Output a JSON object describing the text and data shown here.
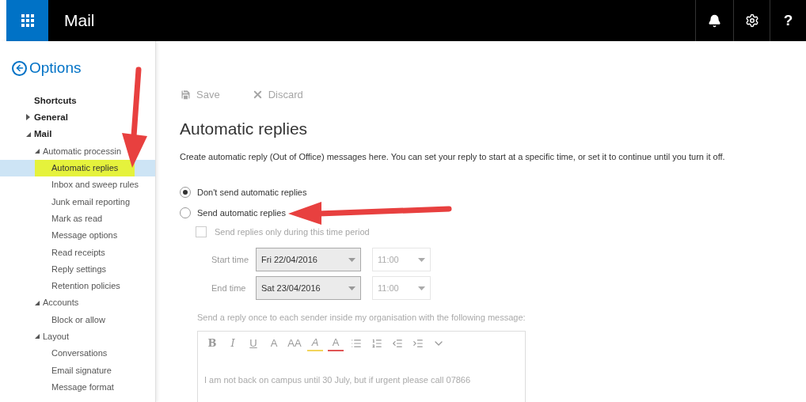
{
  "app_bar": {
    "title": "Mail",
    "help_label": "?"
  },
  "sidebar": {
    "back_label": "Options",
    "items": [
      {
        "label": "Shortcuts",
        "selected": false
      },
      {
        "label": "General",
        "expanded": false,
        "selected": false
      },
      {
        "label": "Mail",
        "expanded": true,
        "selected": false,
        "children": [
          {
            "label": "Automatic processin",
            "expanded": true,
            "selected": false,
            "children": [
              {
                "label": "Automatic replies",
                "selected": true,
                "highlighted": true
              },
              {
                "label": "Inbox and sweep rules",
                "selected": false
              },
              {
                "label": "Junk email reporting",
                "selected": false
              },
              {
                "label": "Mark as read",
                "selected": false
              },
              {
                "label": "Message options",
                "selected": false
              },
              {
                "label": "Read receipts",
                "selected": false
              },
              {
                "label": "Reply settings",
                "selected": false
              },
              {
                "label": "Retention policies",
                "selected": false
              }
            ]
          },
          {
            "label": "Accounts",
            "expanded": true,
            "selected": false,
            "children": [
              {
                "label": "Block or allow",
                "selected": false
              }
            ]
          },
          {
            "label": "Layout",
            "expanded": true,
            "selected": false,
            "children": [
              {
                "label": "Conversations",
                "selected": false
              },
              {
                "label": "Email signature",
                "selected": false
              },
              {
                "label": "Message format",
                "selected": false
              }
            ]
          }
        ]
      }
    ]
  },
  "toolbar": [
    {
      "kind": "save",
      "label": "Save",
      "disabled": true
    },
    {
      "kind": "discard",
      "label": "Discard",
      "disabled": true
    }
  ],
  "heading": "Automatic replies",
  "description": "Create automatic reply (Out of Office) messages here. You can set your reply to start at a specific time, or set it to continue until you turn it off.",
  "radios": [
    {
      "label": "Don't send automatic replies",
      "selected": true
    },
    {
      "label": "Send automatic replies",
      "selected": false
    }
  ],
  "time_period": {
    "label": "Send replies only during this time period",
    "checked": false,
    "disabled": true
  },
  "times": [
    {
      "label": "Start time",
      "date": "Fri 22/04/2016",
      "time": "11:00"
    },
    {
      "label": "End time",
      "date": "Sat 23/04/2016",
      "time": "11:00"
    }
  ],
  "message_label": "Send a reply once to each sender inside my organisation with the following message:",
  "editor_tools": [
    {
      "kind": "bold",
      "label": "B"
    },
    {
      "kind": "italic",
      "label": "I"
    },
    {
      "kind": "underline",
      "label": "U"
    },
    {
      "kind": "grow",
      "label": "A"
    },
    {
      "kind": "shrink",
      "label": "AA"
    },
    {
      "kind": "highlight",
      "label": "A"
    },
    {
      "kind": "color",
      "label": "A"
    },
    {
      "kind": "bullets"
    },
    {
      "kind": "numbers"
    },
    {
      "kind": "outdent"
    },
    {
      "kind": "indent"
    },
    {
      "kind": "more"
    }
  ],
  "message": "I am not back on campus until 30 July, but if urgent please call 07866"
}
